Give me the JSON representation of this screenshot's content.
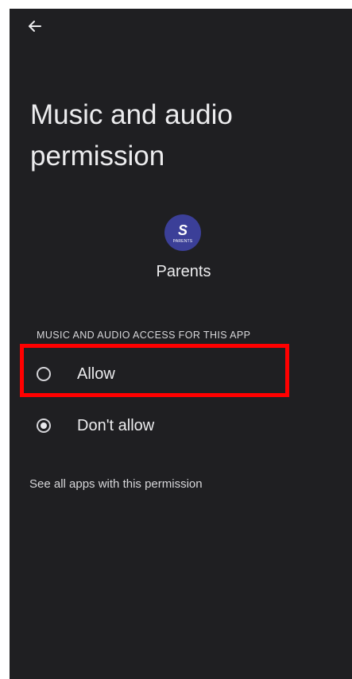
{
  "header": {
    "back_icon": "arrow-left-icon"
  },
  "page": {
    "title": "Music and audio permission"
  },
  "app": {
    "name": "Parents",
    "icon_glyph": "S",
    "icon_text": "PARENTS",
    "icon_color": "#3b3f98"
  },
  "section": {
    "label": "MUSIC AND AUDIO ACCESS FOR THIS APP"
  },
  "options": [
    {
      "label": "Allow",
      "selected": false
    },
    {
      "label": "Don't allow",
      "selected": true
    }
  ],
  "footer_link": {
    "label": "See all apps with this permission"
  },
  "colors": {
    "background": "#1f1f22",
    "highlight": "#ff0000"
  }
}
